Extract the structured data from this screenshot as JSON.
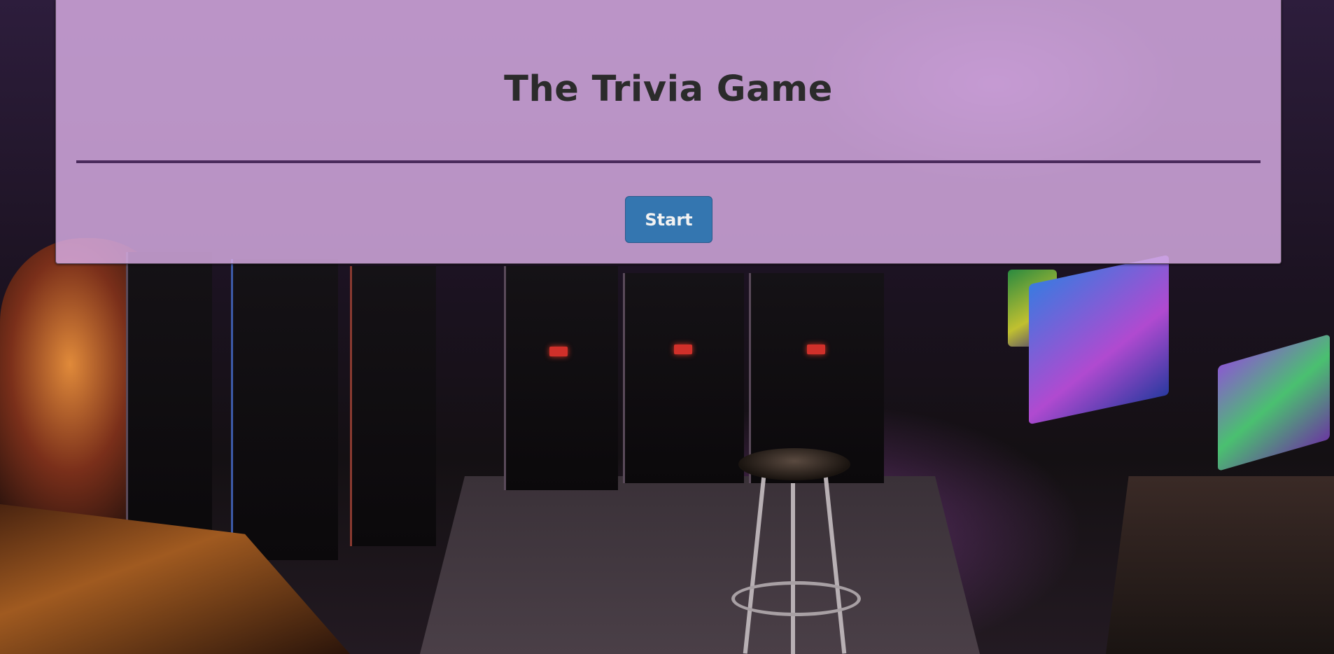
{
  "header": {
    "title": "The Trivia Game"
  },
  "controls": {
    "start_label": "Start"
  },
  "colors": {
    "panel_overlay": "#d6ace2",
    "divider": "#4a2a5c",
    "start_button": "#3476b0",
    "title_text": "#2b2b2b"
  }
}
